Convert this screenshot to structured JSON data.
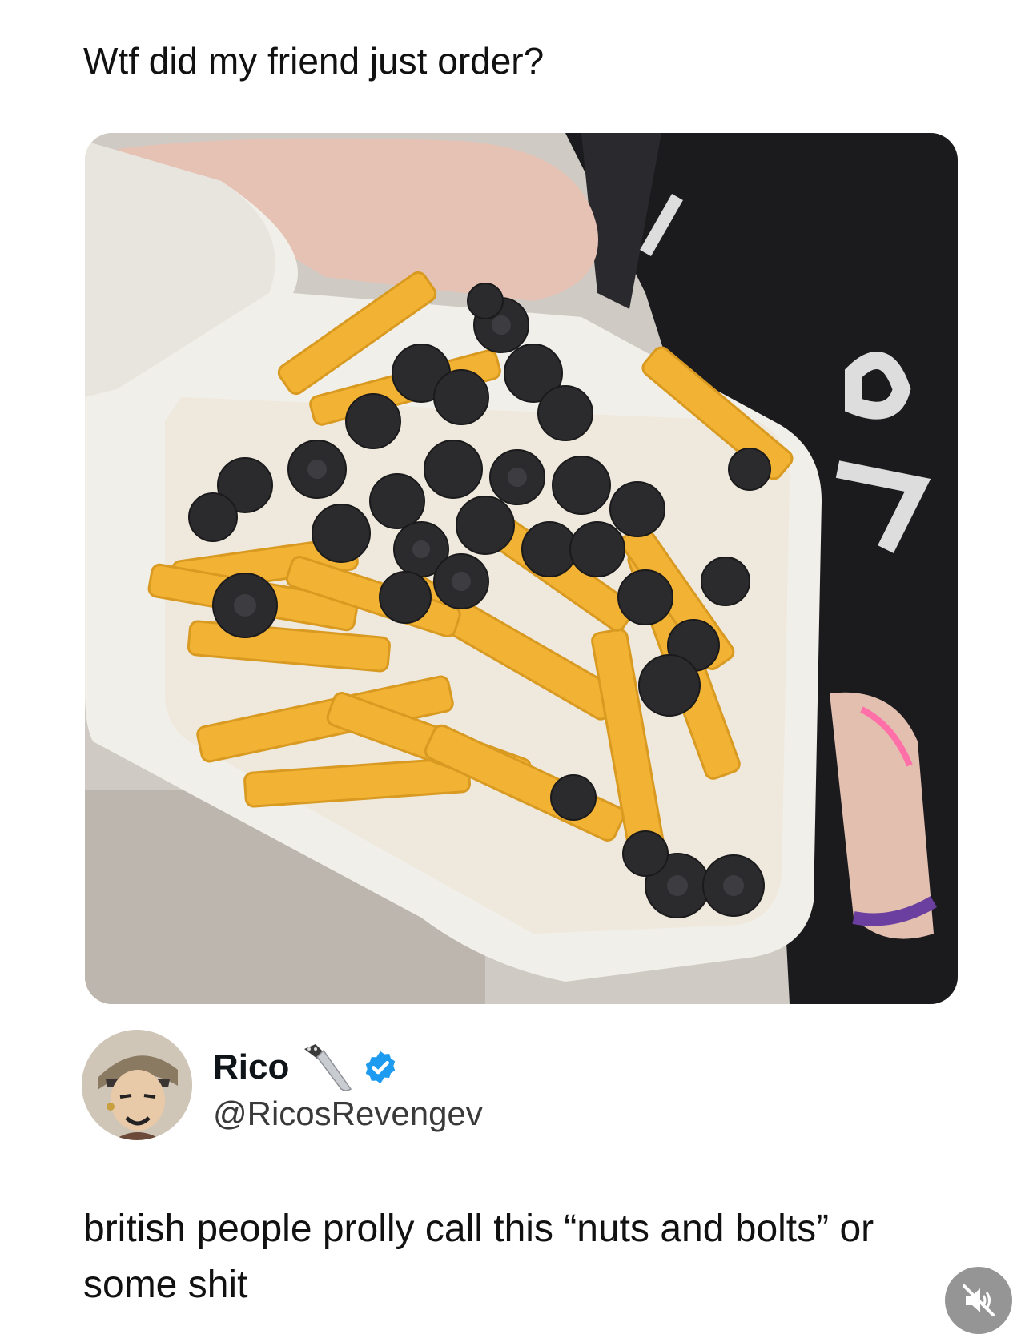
{
  "post": {
    "caption": "Wtf did my friend just order?"
  },
  "author": {
    "display_name": "Rico",
    "name_emoji": "knife-icon",
    "verified": true,
    "handle": "@RicosRevengev"
  },
  "reply": {
    "text": "british people prolly call this “nuts and bolts” or some shit"
  },
  "media_controls": {
    "mute_icon": "muted-speaker-icon"
  },
  "colors": {
    "verified_badge": "#1d9bf0",
    "fries": "#f2b233",
    "olives": "#2b2b2e",
    "container": "#f1efe9",
    "jacket": "#1a1a1c"
  }
}
